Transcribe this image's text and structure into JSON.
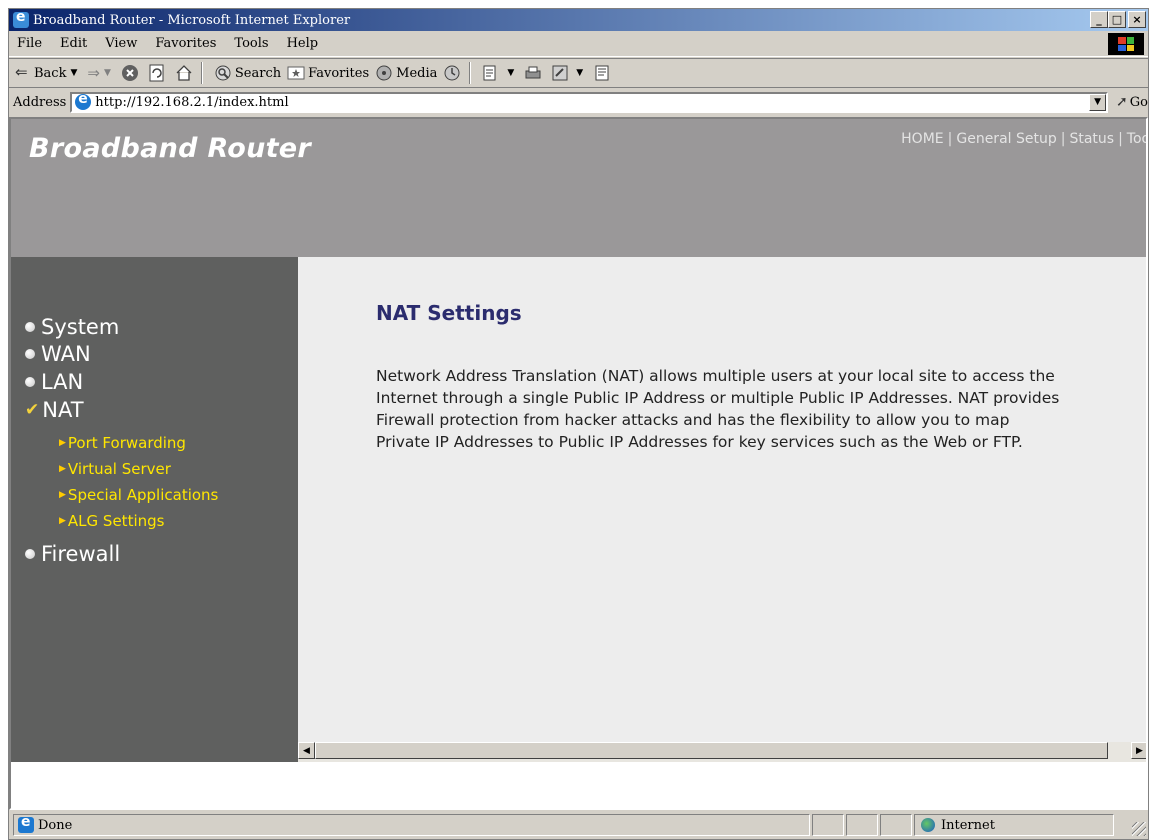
{
  "window": {
    "title": "Broadband Router - Microsoft Internet Explorer",
    "buttons": {
      "minimize": "_",
      "maximize": "□",
      "close": "×"
    }
  },
  "menubar": {
    "items": [
      {
        "label": "File"
      },
      {
        "label": "Edit"
      },
      {
        "label": "View"
      },
      {
        "label": "Favorites"
      },
      {
        "label": "Tools"
      },
      {
        "label": "Help"
      }
    ]
  },
  "toolbar": {
    "back": "Back",
    "search": "Search",
    "favorites": "Favorites",
    "media": "Media"
  },
  "address": {
    "label": "Address",
    "url": "http://192.168.2.1/index.html",
    "go": "Go"
  },
  "page": {
    "brand": "Broadband Router",
    "topnav": [
      "HOME",
      "General Setup",
      "Status",
      "Tool"
    ],
    "sidebar": {
      "items": [
        {
          "label": "System",
          "icon": "bullet-icon"
        },
        {
          "label": "WAN",
          "icon": "bullet-icon"
        },
        {
          "label": "LAN",
          "icon": "bullet-icon"
        },
        {
          "label": "NAT",
          "icon": "check-icon"
        },
        {
          "label": "Firewall",
          "icon": "bullet-icon"
        }
      ],
      "subitems": [
        {
          "label": "Port Forwarding"
        },
        {
          "label": "Virtual Server"
        },
        {
          "label": "Special Applications"
        },
        {
          "label": "ALG Settings"
        }
      ]
    },
    "main": {
      "title": "NAT Settings",
      "description": "Network Address Translation (NAT) allows multiple users at your local site to access the Internet through a single Public IP Address or multiple Public IP Addresses. NAT provides Firewall protection from hacker attacks and has the flexibility to allow you to map Private IP Addresses to Public IP Addresses for key services such as the Web or FTP."
    }
  },
  "status": {
    "text": "Done",
    "zone": "Internet"
  },
  "colors": {
    "header_bg": "#9a9899",
    "sidebar_bg": "#5f605f",
    "main_bg": "#ededed",
    "title_color": "#2b2c6e",
    "submenu_color": "#ffe600"
  }
}
